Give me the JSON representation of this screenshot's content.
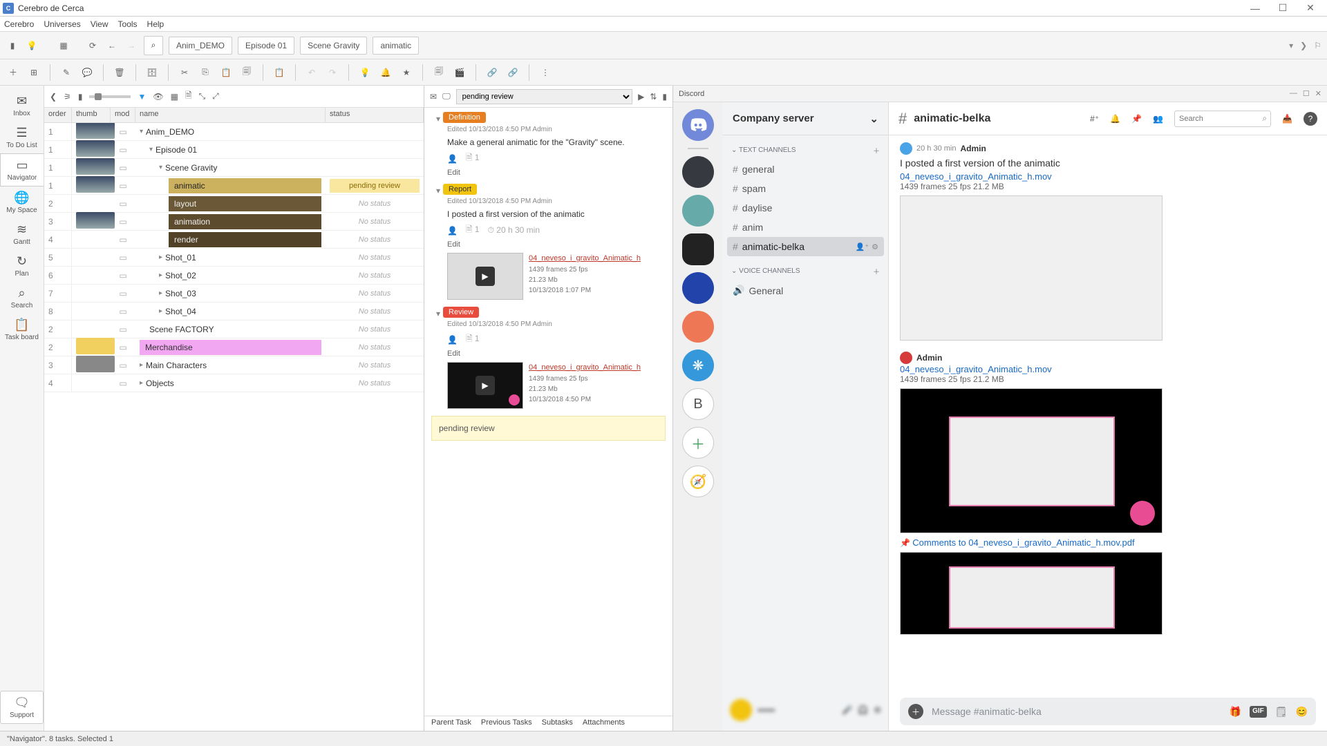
{
  "window": {
    "title": "Cerebro de Cerca"
  },
  "menubar": [
    "Cerebro",
    "Universes",
    "View",
    "Tools",
    "Help"
  ],
  "breadcrumbs": [
    "Anim_DEMO",
    "Episode 01",
    "Scene Gravity",
    "animatic"
  ],
  "sidebar": {
    "items": [
      {
        "label": "Inbox",
        "icon": "✉"
      },
      {
        "label": "To Do List",
        "icon": "☰"
      },
      {
        "label": "Navigator",
        "icon": "▭",
        "active": true
      },
      {
        "label": "My Space",
        "icon": "⊕"
      },
      {
        "label": "Gantt",
        "icon": "≋"
      },
      {
        "label": "Plan",
        "icon": "↻"
      },
      {
        "label": "Search",
        "icon": "⌕"
      },
      {
        "label": "Task board",
        "icon": "▢"
      }
    ],
    "support": "Support"
  },
  "navigator": {
    "columns": {
      "order": "order",
      "thumb": "thumb",
      "mod": "mod",
      "name": "name",
      "status": "status"
    },
    "rows": [
      {
        "ord": "1",
        "indent": 0,
        "caret": "▾",
        "name": "Anim_DEMO",
        "status": "",
        "thumb": true
      },
      {
        "ord": "1",
        "indent": 1,
        "caret": "▾",
        "name": "Episode 01",
        "status": "",
        "thumb": true
      },
      {
        "ord": "1",
        "indent": 2,
        "caret": "▾",
        "name": "Scene Gravity",
        "status": "",
        "thumb": true
      },
      {
        "ord": "1",
        "indent": 3,
        "name": "animatic",
        "status": "pending review",
        "thumb": true,
        "sel": true
      },
      {
        "ord": "2",
        "indent": 3,
        "name": "layout",
        "status": "No status",
        "fill": "fill-layout"
      },
      {
        "ord": "3",
        "indent": 3,
        "name": "animation",
        "status": "No status",
        "fill": "fill-anim",
        "thumb": true
      },
      {
        "ord": "4",
        "indent": 3,
        "name": "render",
        "status": "No status",
        "fill": "fill-render"
      },
      {
        "ord": "5",
        "indent": 2,
        "caret": "▸",
        "name": "Shot_01",
        "status": "No status"
      },
      {
        "ord": "6",
        "indent": 2,
        "caret": "▸",
        "name": "Shot_02",
        "status": "No status"
      },
      {
        "ord": "7",
        "indent": 2,
        "caret": "▸",
        "name": "Shot_03",
        "status": "No status"
      },
      {
        "ord": "8",
        "indent": 2,
        "caret": "▸",
        "name": "Shot_04",
        "status": "No status"
      },
      {
        "ord": "2",
        "indent": 1,
        "name": "Scene FACTORY",
        "status": "No status"
      },
      {
        "ord": "2",
        "indent": 0,
        "name": "Merchandise",
        "status": "No status",
        "merch": true,
        "thumb": "y"
      },
      {
        "ord": "3",
        "indent": 0,
        "caret": "▸",
        "name": "Main Characters",
        "status": "No status",
        "thumb": "g"
      },
      {
        "ord": "4",
        "indent": 0,
        "caret": "▸",
        "name": "Objects",
        "status": "No status"
      }
    ]
  },
  "messages": {
    "dropdown": "pending review",
    "blocks": [
      {
        "tag": "Definition",
        "tagClass": "tag-def",
        "meta": "Edited 10/13/2018 4:50 PM    Admin",
        "text": "Make a general animatic for the \"Gravity\" scene.",
        "edit": "Edit"
      },
      {
        "tag": "Report",
        "tagClass": "tag-rep",
        "meta": "Edited 10/13/2018 4:50 PM    Admin",
        "text": "I posted a first version of the animatic",
        "edit": "Edit",
        "time": "20 h 30 min",
        "attach": {
          "fname": "04_neveso_i_gravito_Animatic_h",
          "frames": "1439 frames 25 fps",
          "size": "21.23 Mb",
          "date": "10/13/2018 1:07 PM",
          "dark": false
        }
      },
      {
        "tag": "Review",
        "tagClass": "tag-rev",
        "meta": "Edited 10/13/2018 4:50 PM    Admin",
        "text": "",
        "edit": "Edit",
        "attach": {
          "fname": "04_neveso_i_gravito_Animatic_h",
          "frames": "1439 frames 25 fps",
          "size": "21.23 Mb",
          "date": "10/13/2018 4:50 PM",
          "dark": true,
          "badge": true
        }
      }
    ],
    "pending": "pending review",
    "footer": [
      "Parent Task",
      "Previous Tasks",
      "Subtasks",
      "Attachments"
    ]
  },
  "discord": {
    "title": "Discord",
    "server": "Company server",
    "textChannelsLabel": "TEXT CHANNELS",
    "voiceChannelsLabel": "VOICE CHANNELS",
    "textChannels": [
      {
        "name": "general"
      },
      {
        "name": "spam"
      },
      {
        "name": "daylise"
      },
      {
        "name": "anim"
      },
      {
        "name": "animatic-belka",
        "active": true
      }
    ],
    "voiceChannels": [
      {
        "name": "General"
      }
    ],
    "arena": {
      "channel": "animatic-belka",
      "searchPlaceholder": "Search",
      "messages": [
        {
          "avatar": "av-blue",
          "time": "20 h 30 min",
          "name": "Admin",
          "body": "I posted a first version of the animatic",
          "link": "04_neveso_i_gravito_Animatic_h.mov",
          "info": "1439 frames 25 fps 21.2 MB",
          "thumb": "light"
        },
        {
          "avatar": "av-red",
          "name": "Admin",
          "link": "04_neveso_i_gravito_Animatic_h.mov",
          "info": "1439 frames 25 fps 21.2 MB",
          "thumb": "dark",
          "pinkBadge": true,
          "commentLink": "Comments to 04_neveso_i_gravito_Animatic_h.mov.pdf",
          "thumb2": "dark"
        }
      ],
      "inputPlaceholder": "Message #animatic-belka"
    }
  },
  "statusbar": "\"Navigator\". 8 tasks. Selected 1"
}
